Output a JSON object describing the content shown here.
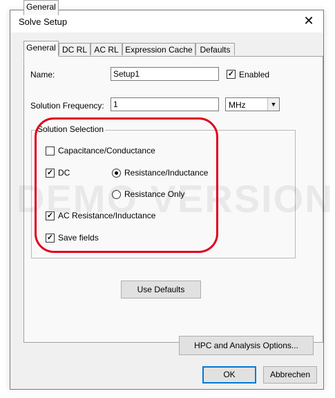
{
  "window": {
    "title": "Solve Setup",
    "close_glyph": "✕"
  },
  "tabs": [
    {
      "label": "General",
      "active": true
    },
    {
      "label": "DC RL",
      "active": false
    },
    {
      "label": "AC RL",
      "active": false
    },
    {
      "label": "Expression Cache",
      "active": false
    },
    {
      "label": "Defaults",
      "active": false
    }
  ],
  "form": {
    "name_label": "Name:",
    "name_value": "Setup1",
    "enabled_label": "Enabled",
    "enabled_checked": true,
    "freq_label": "Solution Frequency:",
    "freq_value": "1",
    "freq_unit": "MHz"
  },
  "solution_selection": {
    "title": "Solution Selection",
    "capacitance_label": "Capacitance/Conductance",
    "capacitance_checked": false,
    "dc_label": "DC",
    "dc_checked": true,
    "radio_res_ind_label": "Resistance/Inductance",
    "radio_res_ind_selected": true,
    "radio_res_only_label": "Resistance Only",
    "radio_res_only_selected": false,
    "ac_label": "AC Resistance/Inductance",
    "ac_checked": true,
    "save_fields_label": "Save fields",
    "save_fields_checked": true
  },
  "watermark": "DEMO VERSION",
  "buttons": {
    "use_defaults": "Use Defaults",
    "hpc": "HPC and Analysis Options...",
    "ok": "OK",
    "cancel": "Abbrechen"
  },
  "check_glyph": "✓",
  "colors": {
    "highlight": "#e0001a",
    "accent": "#0078d7"
  }
}
